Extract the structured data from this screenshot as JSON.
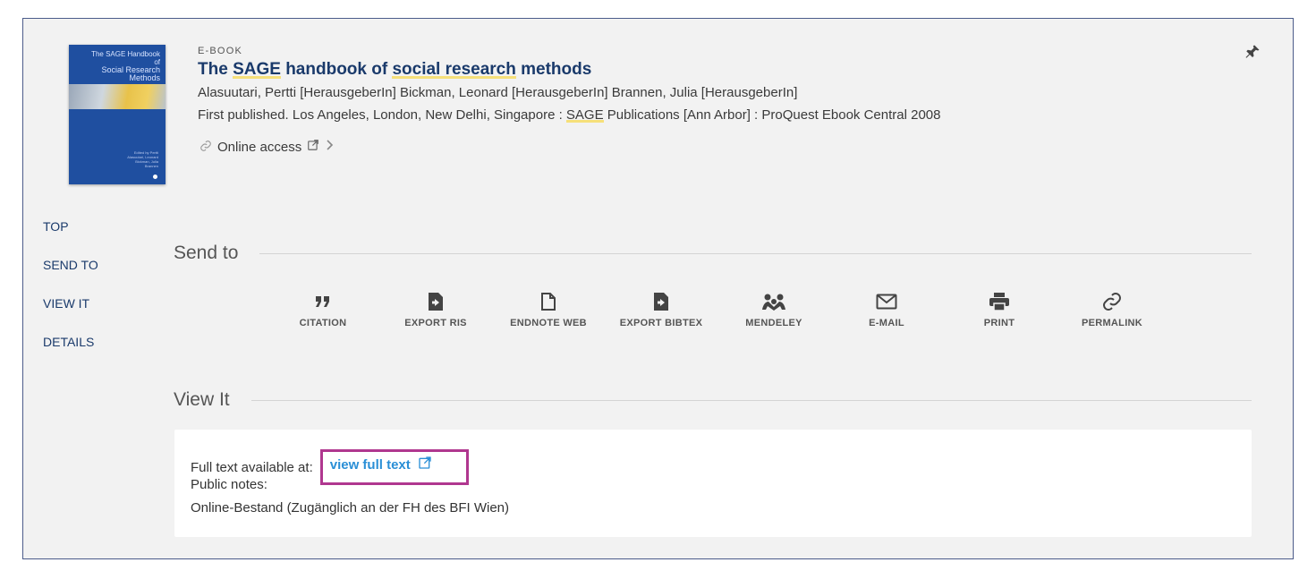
{
  "record": {
    "type": "E-BOOK",
    "title_parts": [
      "The ",
      "SAGE",
      " handbook of ",
      "social research",
      " methods"
    ],
    "authors": "Alasuutari, Pertti [HerausgeberIn] Bickman, Leonard [HerausgeberIn] Brannen, Julia [HerausgeberIn]",
    "publisher_before": "First published. Los Angeles, London, New Delhi, Singapore : ",
    "publisher_hl": "SAGE",
    "publisher_after": " Publications [Ann Arbor] : ProQuest Ebook Central 2008",
    "online_access": "Online access",
    "cover": {
      "title_line1": "The SAGE Handbook of",
      "title_line2": "Social Research",
      "title_line3": "Methods",
      "editors": "Edited by Pertti Alasuutari, Leonard Bickman, Julia Brannen"
    }
  },
  "nav": {
    "items": [
      "TOP",
      "SEND TO",
      "VIEW IT",
      "DETAILS"
    ]
  },
  "send_to": {
    "heading": "Send to",
    "actions": [
      {
        "label": "CITATION",
        "icon": "quote-icon"
      },
      {
        "label": "EXPORT RIS",
        "icon": "export-file-icon"
      },
      {
        "label": "ENDNOTE WEB",
        "icon": "document-icon"
      },
      {
        "label": "EXPORT BIBTEX",
        "icon": "export-file-icon"
      },
      {
        "label": "MENDELEY",
        "icon": "mendeley-icon"
      },
      {
        "label": "E-MAIL",
        "icon": "envelope-icon"
      },
      {
        "label": "PRINT",
        "icon": "printer-icon"
      },
      {
        "label": "PERMALINK",
        "icon": "link-icon"
      }
    ]
  },
  "view_it": {
    "heading": "View It",
    "full_text_label": "Full text available at:",
    "full_text_link": "view full text",
    "public_notes_label": "Public notes:",
    "note": "Online-Bestand (Zugänglich an der FH des BFI Wien)"
  },
  "colors": {
    "title": "#1a3a6b",
    "link": "#2a8fd6",
    "highlight_box": "#b0378f",
    "panel_bg": "#f2f2f2",
    "panel_border": "#4c5c8a",
    "cover_blue": "#1f4fa0",
    "keyword_highlight": "#f6e07a"
  }
}
